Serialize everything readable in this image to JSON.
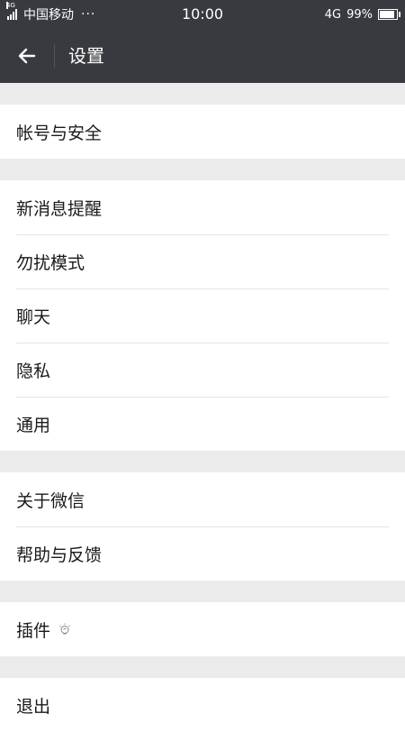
{
  "status_bar": {
    "network_small": "4G",
    "carrier": "中国移动",
    "dots": "···",
    "time": "10:00",
    "network_type": "4G",
    "battery_text": "99%",
    "battery_level": 0.99
  },
  "header": {
    "back_icon": "back-arrow-icon",
    "title": "设置"
  },
  "groups": [
    {
      "items": [
        "帐号与安全"
      ]
    },
    {
      "items": [
        "新消息提醒",
        "勿扰模式",
        "聊天",
        "隐私",
        "通用"
      ]
    },
    {
      "items": [
        "关于微信",
        "帮助与反馈"
      ]
    },
    {
      "items": [
        "插件"
      ],
      "plugin_icon": "lightbulb-icon"
    },
    {
      "items": [
        "退出"
      ]
    }
  ],
  "colors": {
    "header_bg": "#393a3f",
    "page_bg": "#ebebeb",
    "item_bg": "#ffffff"
  }
}
